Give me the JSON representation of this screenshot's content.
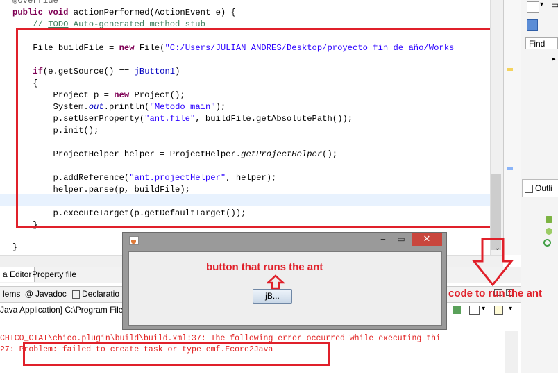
{
  "editor": {
    "lines": [
      {
        "text": "@Override",
        "style": "annotation"
      },
      {
        "text": "public void actionPerformed(ActionEvent e) {"
      },
      {
        "text": "    // TODO Auto-generated method stub"
      },
      {
        "text": ""
      },
      {
        "text": "    File buildFile = new File(\"C:/Users/JULIAN ANDRES/Desktop/proyecto fin de año/Works"
      },
      {
        "text": ""
      },
      {
        "text": "    if(e.getSource() == jButton1)"
      },
      {
        "text": "    {"
      },
      {
        "text": "        Project p = new Project();"
      },
      {
        "text": "        System.out.println(\"Metodo main\");"
      },
      {
        "text": "        p.setUserProperty(\"ant.file\", buildFile.getAbsolutePath());"
      },
      {
        "text": "        p.init();"
      },
      {
        "text": ""
      },
      {
        "text": "        ProjectHelper helper = ProjectHelper.getProjectHelper();"
      },
      {
        "text": ""
      },
      {
        "text": "        p.addReference(\"ant.projectHelper\", helper);"
      },
      {
        "text": "        helper.parse(p, buildFile);"
      },
      {
        "text": ""
      },
      {
        "text": "        p.executeTarget(p.getDefaultTarget());"
      },
      {
        "text": "    }"
      },
      {
        "text": ""
      },
      {
        "text": "}"
      }
    ]
  },
  "right_panel": {
    "find_placeholder": "Find",
    "outline_label": "Outli"
  },
  "tabs": {
    "editor_tab": "a Editor",
    "property_tab": "Property file",
    "problems_tab": "lems",
    "javadoc_tab": "Javadoc",
    "declaration_tab": "Declaratio"
  },
  "console": {
    "title": "Java Application] C:\\Program Files",
    "line1": "CHICO_CIAT\\chico.plugin\\build\\build.xml:37: The following error occurred while executing thi",
    "line2": "27: Problem: failed to create task or type emf.Ecore2Java"
  },
  "jframe": {
    "button_label": "jB..."
  },
  "annotations": {
    "button_note": "button that runs the ant",
    "code_note": "code to run the ant"
  },
  "colors": {
    "annotation_red": "#e0202a",
    "keyword": "#7f0055",
    "string": "#2a00ff",
    "comment": "#3f7f5f",
    "error_text": "#e12020",
    "close_button": "#c9463d"
  }
}
